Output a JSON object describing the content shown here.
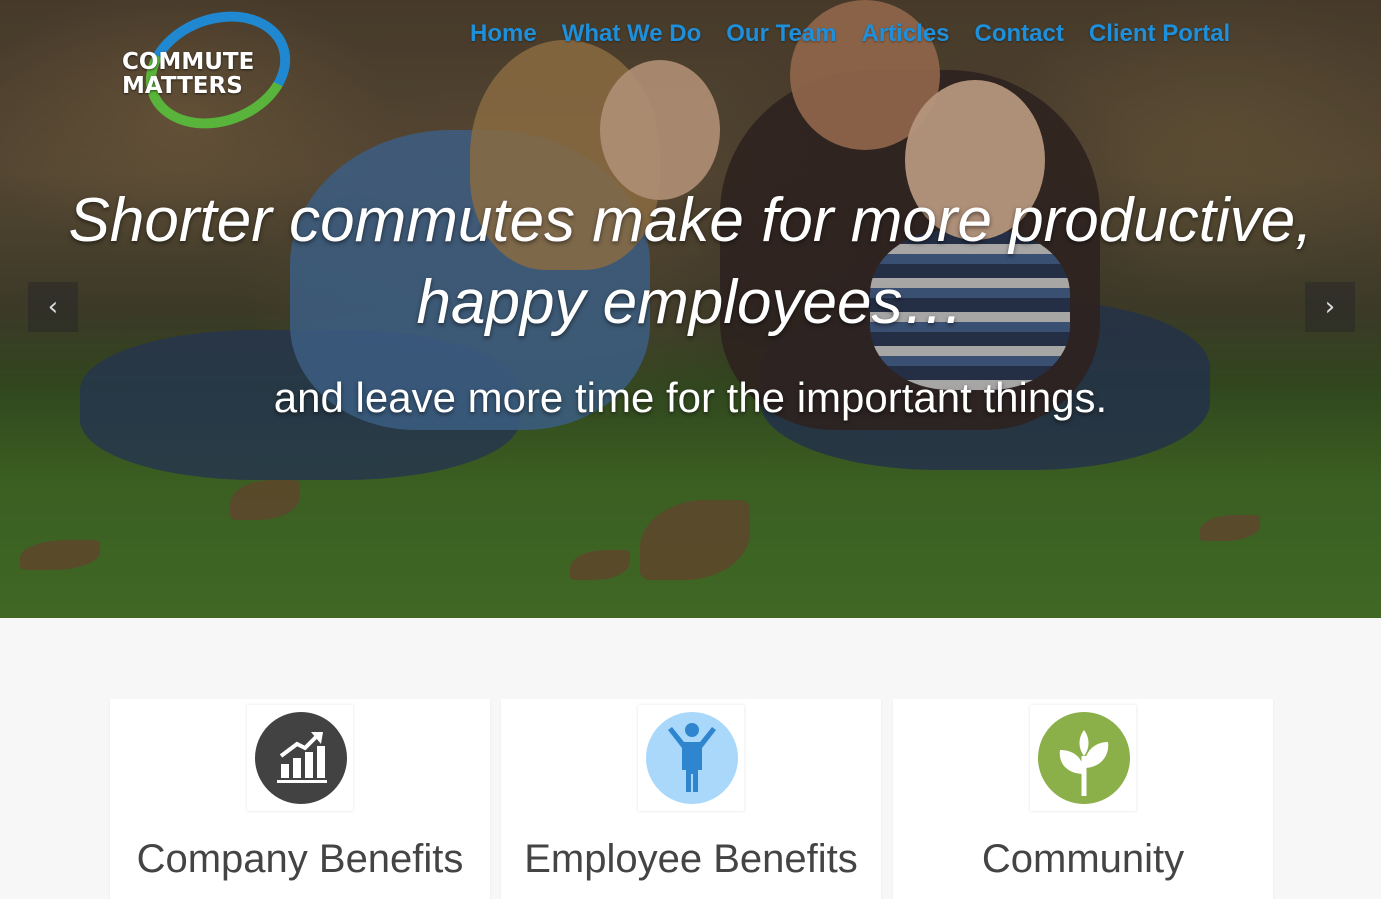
{
  "brand": {
    "logo_line1": "COMMUTE",
    "logo_line2": "MATTERS",
    "ring_colors": [
      "#1f88d0",
      "#58b43a"
    ]
  },
  "nav": {
    "items": [
      {
        "label": "Home"
      },
      {
        "label": "What We Do"
      },
      {
        "label": "Our Team"
      },
      {
        "label": "Articles"
      },
      {
        "label": "Contact"
      },
      {
        "label": "Client Portal"
      }
    ],
    "color": "#1d8fdb"
  },
  "hero": {
    "headline_line1": "Shorter commutes make for more productive,",
    "headline_line2": "happy employees…",
    "subline": "and leave more time for the important things.",
    "prev_icon": "chevron-left-icon",
    "next_icon": "chevron-right-icon",
    "prev_glyph": "‹",
    "next_glyph": "›"
  },
  "features": {
    "cards": [
      {
        "title": "Company Benefits",
        "icon": "growth-chart-icon",
        "icon_color": "#424242"
      },
      {
        "title": "Employee Benefits",
        "icon": "person-icon",
        "icon_color": "#a9d8fb"
      },
      {
        "title": "Community",
        "icon": "plant-icon",
        "icon_color": "#8bb04a"
      }
    ]
  }
}
